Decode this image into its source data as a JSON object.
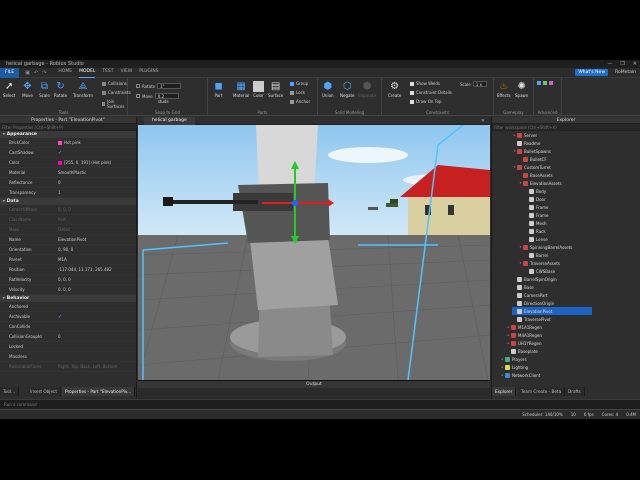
{
  "window": {
    "title": "helical garbage - Roblox Studio",
    "controls": [
      "—",
      "❐",
      "✕"
    ]
  },
  "menubar": {
    "file": "FILE",
    "tabs": [
      "HOME",
      "MODEL",
      "TEST",
      "VIEW",
      "PLUGINS"
    ],
    "active_tab": "MODEL",
    "whats_new": "What's New",
    "user": "RoMetain"
  },
  "ribbon": {
    "tools": {
      "title": "Tools",
      "select": "Select",
      "move": "Move",
      "scale": "Scale",
      "rotate": "Rotate",
      "transform": "Transform",
      "collisions": "Collisions",
      "constraints": "Constraints",
      "join_surfaces": "Join Surfaces"
    },
    "snap": {
      "title": "Snap to Grid",
      "rotate_label": "Rotate",
      "rotate_value": "1°",
      "move_label": "Move",
      "move_value": "0.2 studs"
    },
    "parts": {
      "title": "Parts",
      "part": "Part",
      "material": "Material",
      "color": "Color",
      "surface": "Surface",
      "group": "Group",
      "lock": "Lock",
      "anchor": "Anchor"
    },
    "solid": {
      "title": "Solid Modeling",
      "union": "Union",
      "negate": "Negate",
      "separate": "Separate"
    },
    "constraints": {
      "title": "Constraints",
      "create": "Create",
      "show_welds": "Show Welds",
      "constraint_details": "Constraint Details",
      "draw_on_top": "Draw On Top",
      "scale_label": "Scale",
      "scale_value": "1 x"
    },
    "gameplay": {
      "title": "Gameplay",
      "effects": "Effects",
      "spawn": "Spawn"
    },
    "advanced": {
      "title": "Advanced"
    }
  },
  "properties": {
    "header": "Properties - Part \"ElevationPivot\"",
    "filter_placeholder": "Filter Properties (Ctrl+Shift+P)",
    "sections": [
      {
        "name": "Appearance",
        "rows": [
          {
            "name": "BrickColor",
            "value": "Hot pink",
            "swatch": "#ff45c8"
          },
          {
            "name": "CastShadow",
            "check": true
          },
          {
            "name": "Color",
            "value": "[255, 0, 191] (Hot pink)",
            "swatch": "#ff00bf"
          },
          {
            "name": "Material",
            "value": "SmoothPlastic"
          },
          {
            "name": "Reflectance",
            "value": "0"
          },
          {
            "name": "Transparency",
            "value": "1"
          }
        ]
      },
      {
        "name": "Data",
        "rows": [
          {
            "name": "CenterOfMass",
            "value": "0, 0, 0",
            "dim": true
          },
          {
            "name": "ClassName",
            "value": "Part",
            "dim": true
          },
          {
            "name": "Mass",
            "value": "Detail",
            "dim": true
          },
          {
            "name": "Name",
            "value": "ElevationPivot"
          },
          {
            "name": "Orientation",
            "value": "0, 90, 0"
          },
          {
            "name": "Parent",
            "value": "M1A"
          },
          {
            "name": "Position",
            "value": "-117.044, 11.171, 265.482"
          },
          {
            "name": "RotVelocity",
            "value": "0, 0, 0"
          },
          {
            "name": "Velocity",
            "value": "0, 0, 0"
          }
        ]
      },
      {
        "name": "Behavior",
        "rows": [
          {
            "name": "Anchored",
            "check": false
          },
          {
            "name": "Archivable",
            "check": true
          },
          {
            "name": "CanCollide",
            "check": false
          },
          {
            "name": "CollisionGroupId",
            "value": "0"
          },
          {
            "name": "Locked",
            "check": false
          },
          {
            "name": "Massless",
            "check": false
          },
          {
            "name": "ResizeableFaces",
            "value": "Right, Top, Back, Left, Bottom",
            "dim": true
          }
        ]
      }
    ]
  },
  "viewport": {
    "tab": "helical garbage",
    "close": "✕",
    "output_title": "Output"
  },
  "explorer": {
    "header": "Explorer",
    "filter_placeholder": "Filter workspace (Ctrl+Shift+X)",
    "items": [
      {
        "label": "Server",
        "depth": 1,
        "color": "#c44",
        "arrow": "▸"
      },
      {
        "label": "Readme",
        "depth": 1,
        "color": "#ccc",
        "arrow": ""
      },
      {
        "label": "BulletSpawns",
        "depth": 1,
        "color": "#c44",
        "arrow": "▾"
      },
      {
        "label": "BulletCF",
        "depth": 2,
        "color": "#c44",
        "arrow": ""
      },
      {
        "label": "CustomTurret",
        "depth": 1,
        "color": "#c44",
        "arrow": "▾"
      },
      {
        "label": "BaseAssets",
        "depth": 2,
        "color": "#c44",
        "arrow": ""
      },
      {
        "label": "ElevationAssets",
        "depth": 2,
        "color": "#c44",
        "arrow": "▾"
      },
      {
        "label": "Body",
        "depth": 3,
        "color": "#ccc",
        "arrow": ""
      },
      {
        "label": "Door",
        "depth": 3,
        "color": "#ccc",
        "arrow": ""
      },
      {
        "label": "Frame",
        "depth": 3,
        "color": "#ccc",
        "arrow": ""
      },
      {
        "label": "Frame",
        "depth": 3,
        "color": "#ccc",
        "arrow": ""
      },
      {
        "label": "Mesh",
        "depth": 3,
        "color": "#ccc",
        "arrow": ""
      },
      {
        "label": "Rack",
        "depth": 3,
        "color": "#ccc",
        "arrow": ""
      },
      {
        "label": "Lense",
        "depth": 3,
        "color": "#ccc",
        "arrow": ""
      },
      {
        "label": "SpinningBarrelAssets",
        "depth": 2,
        "color": "#c44",
        "arrow": "▾"
      },
      {
        "label": "Barrel",
        "depth": 3,
        "color": "#ccc",
        "arrow": ""
      },
      {
        "label": "TraverseAssets",
        "depth": 2,
        "color": "#c44",
        "arrow": "▾"
      },
      {
        "label": "CWSBase",
        "depth": 3,
        "color": "#ccc",
        "arrow": ""
      },
      {
        "label": "BarrelSpinOrigin",
        "depth": 1,
        "color": "#ccc",
        "arrow": ""
      },
      {
        "label": "Base",
        "depth": 1,
        "color": "#ccc",
        "arrow": ""
      },
      {
        "label": "CameraPart",
        "depth": 1,
        "color": "#ccc",
        "arrow": ""
      },
      {
        "label": "DirectionOrigin",
        "depth": 1,
        "color": "#ccc",
        "arrow": ""
      },
      {
        "label": "ElevationPivot",
        "depth": 1,
        "color": "#ccc",
        "arrow": "",
        "selected": true
      },
      {
        "label": "TraversePivot",
        "depth": 1,
        "color": "#ccc",
        "arrow": ""
      },
      {
        "label": "M1A1Regen",
        "depth": 0,
        "color": "#c44",
        "arrow": "▸"
      },
      {
        "label": "M4A1Regen",
        "depth": 0,
        "color": "#c44",
        "arrow": "▸"
      },
      {
        "label": "UH1YRegen",
        "depth": 0,
        "color": "#c44",
        "arrow": "▸"
      },
      {
        "label": "Baseplate",
        "depth": 0,
        "color": "#ccc",
        "arrow": ""
      },
      {
        "label": "Players",
        "depth": -1,
        "color": "#4a8",
        "arrow": "▸"
      },
      {
        "label": "Lighting",
        "depth": -1,
        "color": "#dd4",
        "arrow": "▸"
      },
      {
        "label": "NetworkClient",
        "depth": -1,
        "color": "#48c",
        "arrow": "▸"
      }
    ]
  },
  "bottom_tabs_left": [
    "Tool...",
    "Insert Object",
    "Properties - Part \"ElevationPiv..."
  ],
  "bottom_tabs_right": [
    "Explorer",
    "Team Create - Beta",
    "Drafts"
  ],
  "command_bar": {
    "placeholder": "Run a command"
  },
  "status": {
    "scheduler": "Scheduler: 140/10%",
    "a": "10",
    "fps": "6 fps",
    "cores": "Cores: 4",
    "mem": "0.4M"
  }
}
